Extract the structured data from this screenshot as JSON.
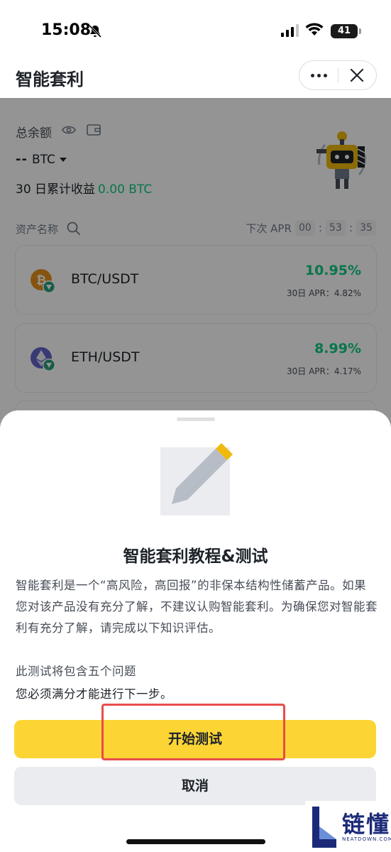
{
  "status_bar": {
    "time": "15:08",
    "battery": "41"
  },
  "header": {
    "title": "智能套利"
  },
  "summary": {
    "total_label": "总余额",
    "balance_value": "--",
    "balance_unit": "BTC",
    "pnl_label": "30 日累计收益",
    "pnl_value": "0.00 BTC"
  },
  "list": {
    "asset_col_label": "资产名称",
    "next_apr_label": "下次 APR",
    "timer": {
      "hours": "00",
      "minutes": "53",
      "seconds": "35"
    },
    "pairs": [
      {
        "name": "BTC/USDT",
        "apr": "10.95%",
        "sub": "30日 APR：4.82%"
      },
      {
        "name": "ETH/USDT",
        "apr": "8.99%",
        "sub": "30日 APR：4.17%"
      }
    ]
  },
  "sheet": {
    "title": "智能套利教程&测试",
    "description": "智能套利是一个“高风险，高回报”的非保本结构性储蓄产品。如果您对该产品没有充分了解，不建议认购智能套利。为确保您对智能套利有充分了解，请完成以下知识评估。",
    "note_1": "此测试将包含五个问题",
    "note_2": "您必须满分才能进行下一步。",
    "primary_button": "开始测试",
    "secondary_button": "取消"
  },
  "watermark": {
    "text": "链懂",
    "sub": "NEATDOWN.COM"
  },
  "colors": {
    "accent_yellow": "#fcd535",
    "positive_green": "#0ecb81",
    "highlight_red": "#e84c4c",
    "text_primary": "#1e2329"
  },
  "icons": [
    "bell-off-icon",
    "signal-icon",
    "wifi-icon",
    "battery-icon",
    "more-icon",
    "close-icon",
    "eye-icon",
    "wallet-icon",
    "search-icon",
    "btc-icon",
    "eth-icon",
    "usdt-icon",
    "pencil-icon"
  ]
}
